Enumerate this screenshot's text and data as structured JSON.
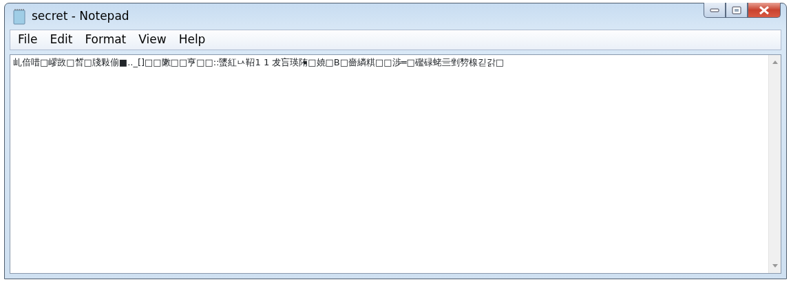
{
  "window": {
    "title": "secret - Notepad"
  },
  "menu": [
    "File",
    "Edit",
    "Format",
    "View",
    "Help"
  ],
  "document": {
    "text": "乢偣唶□嵺敳□晳□牋敤偂■.._[]□□敶□□亨□□::螴紅ㅧ鞀1 1 犮吂瑛陏□嬈□B□嗇繗粸□□渉═□礛碌蛯亖剉剓楾긷갉□"
  }
}
